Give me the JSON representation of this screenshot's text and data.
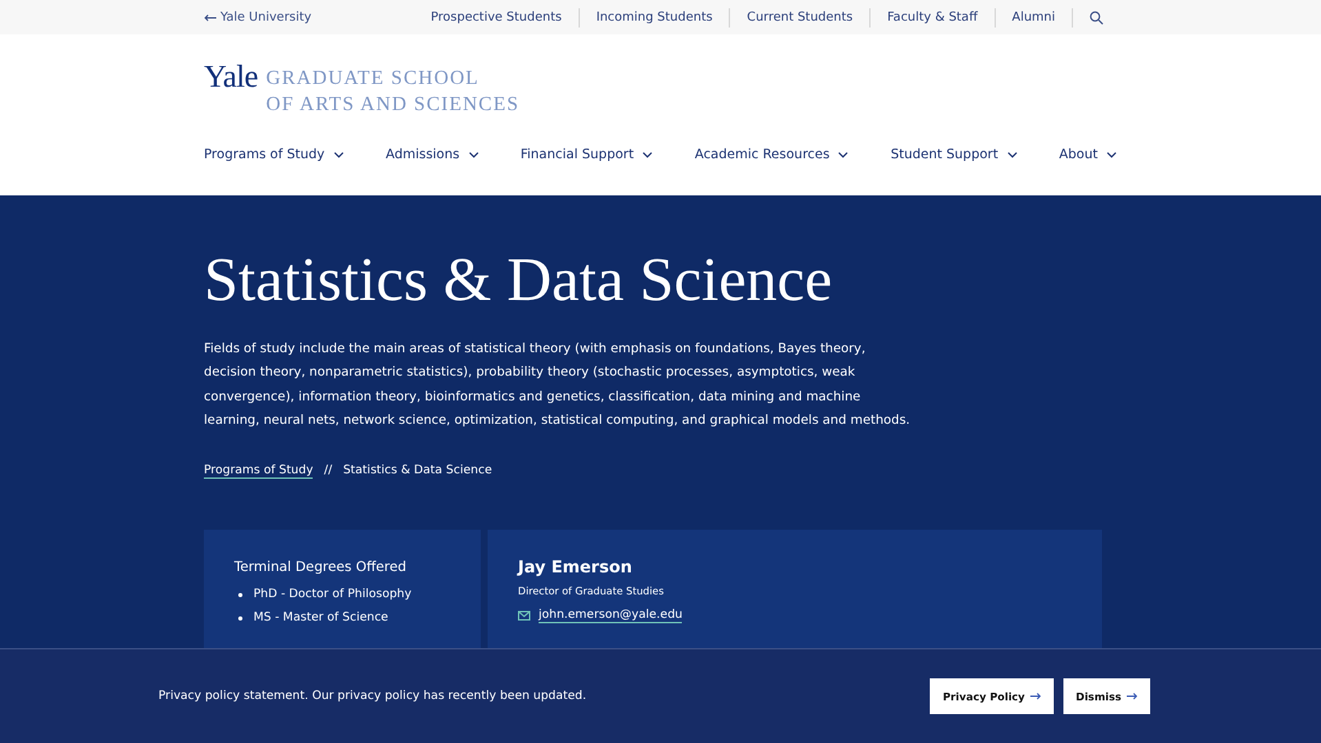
{
  "utility_nav": {
    "back_link": "Yale University",
    "links": [
      "Prospective Students",
      "Incoming Students",
      "Current Students",
      "Faculty & Staff",
      "Alumni"
    ]
  },
  "logo": {
    "wordmark": "Yale",
    "school_line_1": "GRADUATE SCHOOL",
    "school_line_2": "OF ARTS AND SCIENCES"
  },
  "main_nav": [
    "Programs of Study",
    "Admissions",
    "Financial Support",
    "Academic Resources",
    "Student Support",
    "About"
  ],
  "hero": {
    "title": "Statistics & Data Science",
    "description": "Fields of study include the main areas of statistical theory (with emphasis on foundations, Bayes theory, decision theory, nonparametric statistics), probability theory (stochastic processes, asymptotics, weak convergence), information theory, bioinformatics and genetics, classification, data mining and machine learning, neural nets, network science, optimization, statistical computing, and graphical models and methods.",
    "breadcrumb": {
      "parent": "Programs of Study",
      "separator": "//",
      "current": "Statistics & Data Science"
    }
  },
  "degrees_card": {
    "heading": "Terminal Degrees Offered",
    "items": [
      "PhD - Doctor of Philosophy",
      "MS - Master of Science"
    ]
  },
  "contact_card": {
    "name": "Jay Emerson",
    "role": "Director of Graduate Studies",
    "email": "john.emerson@yale.edu"
  },
  "privacy_banner": {
    "message": "Privacy policy statement. Our privacy policy has recently been updated.",
    "buttons": [
      "Privacy Policy",
      "Dismiss"
    ]
  }
}
